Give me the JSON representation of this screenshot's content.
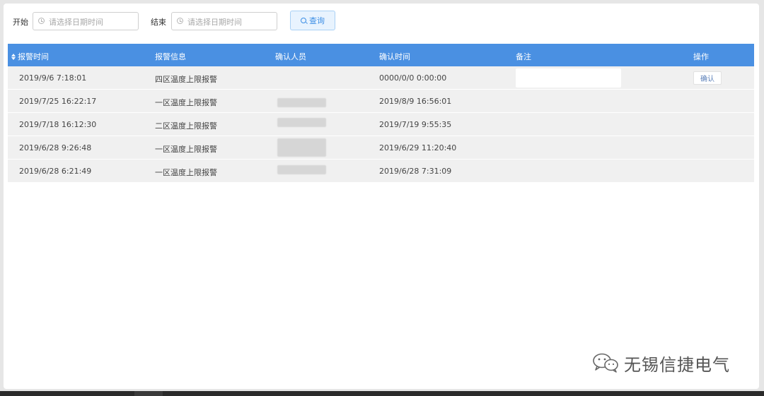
{
  "filter": {
    "start_label": "开始",
    "start_placeholder": "请选择日期时间",
    "end_label": "结束",
    "end_placeholder": "请选择日期时间",
    "query_label": "查询"
  },
  "table": {
    "columns": [
      "报警时间",
      "报警信息",
      "确认人员",
      "确认时间",
      "备注",
      "操作"
    ],
    "rows": [
      {
        "alarm_time": "2019/9/6 7:18:01",
        "alarm_info": "四区温度上限报警",
        "confirm_time": "0000/0/0 0:00:00",
        "action": "确认"
      },
      {
        "alarm_time": "2019/7/25 16:22:17",
        "alarm_info": "一区温度上限报警",
        "confirm_time": "2019/8/9 16:56:01"
      },
      {
        "alarm_time": "2019/7/18 16:12:30",
        "alarm_info": "二区温度上限报警",
        "confirm_time": "2019/7/19 9:55:35"
      },
      {
        "alarm_time": "2019/6/28 9:26:48",
        "alarm_info": "一区温度上限报警",
        "confirm_time": "2019/6/29 11:20:40"
      },
      {
        "alarm_time": "2019/6/28 6:21:49",
        "alarm_info": "一区温度上限报警",
        "confirm_time": "2019/6/28 7:31:09"
      }
    ]
  },
  "watermark": {
    "icon": "wechat-icon",
    "text": "无锡信捷电气"
  },
  "colors": {
    "header_bg": "#4a90e2",
    "row_bg": "#f0f0f0",
    "query_text": "#3b8ee5"
  }
}
